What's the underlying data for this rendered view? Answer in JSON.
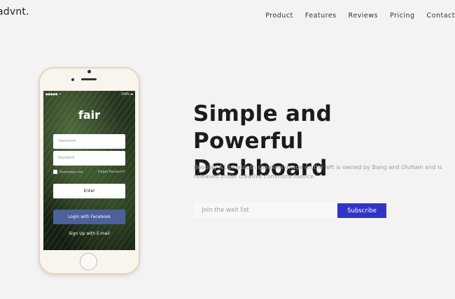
{
  "brand": {
    "logo": "advnt."
  },
  "nav": {
    "items": [
      "Product",
      "Features",
      "Reviews",
      "Pricing",
      "Contact"
    ]
  },
  "phone_app": {
    "logo": "fair",
    "status_left": "●●●●● ᯤ",
    "status_right": "100% ▬",
    "username_placeholder": "Username",
    "password_placeholder": "Password",
    "remember_label": "Remember me",
    "forgot_label": "Forgot Password?",
    "enter_label": "Enter",
    "facebook_label": "Login with Facebook",
    "signup_label": "Sign Up with E-mail"
  },
  "hero": {
    "title_line1": "Simple and Powerful",
    "title_line2": "Dashboard",
    "description": "Beoplay A1 bluetooth speakers image on the left is owned by Bang and Olufsen and is released under creative commons lisence."
  },
  "waitlist": {
    "placeholder": "Join the wait list",
    "button_label": "Subscribe"
  },
  "colors": {
    "accent": "#3135c4",
    "facebook": "#4c6199",
    "background": "#f3f3f3"
  }
}
